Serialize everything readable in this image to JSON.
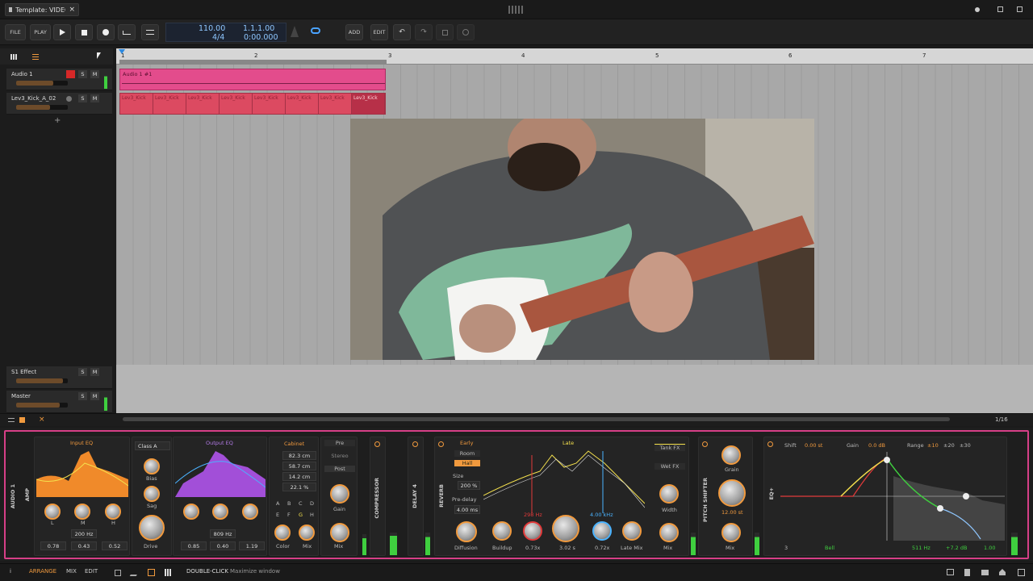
{
  "window": {
    "tab_title": "Template: VIDEO *",
    "close": "×"
  },
  "toolbar": {
    "file": "FILE",
    "play": "PLAY",
    "add": "ADD",
    "edit": "EDIT",
    "tempo": "110.00",
    "signature": "4/4",
    "position": "1.1.1.00",
    "time": "0:00.000"
  },
  "ruler": {
    "bars": [
      "1",
      "2",
      "3",
      "4",
      "5",
      "6",
      "7"
    ]
  },
  "tracks": [
    {
      "name": "Audio 1",
      "level": 0.72,
      "s": "S",
      "m": "M"
    },
    {
      "name": "Lev3_Kick_A_02",
      "level": 0.65,
      "s": "S",
      "m": "M"
    },
    {
      "name": "S1 Effect",
      "level": 0.9,
      "s": "S",
      "m": "M"
    },
    {
      "name": "Master",
      "level": 0.85,
      "s": "S",
      "m": "M"
    }
  ],
  "add_track": "+",
  "clips": {
    "audio_label": "Audio 1 #1",
    "kick_labels": [
      "Lev3_Kick",
      "Lev3_Kick",
      "Lev3_Kick",
      "Lev3_Kick",
      "Lev3_Kick",
      "Lev3_Kick",
      "Lev3_Kick",
      "Lev3_Kick"
    ]
  },
  "arrange_footer": {
    "grid": "1/16"
  },
  "amp": {
    "track_label": "AUDIO 1",
    "device": "AMP",
    "input_eq": "Input EQ",
    "mode": "Class A",
    "bias": "Bias",
    "sag": "Sag",
    "drive": "Drive",
    "output_eq": "Output EQ",
    "lmh": [
      "L",
      "M",
      "H"
    ],
    "in_vals": [
      "0.78",
      "0.43",
      "0.52"
    ],
    "in_freq": "200 Hz",
    "out_vals": [
      "0.85",
      "0.40",
      "1.19"
    ],
    "out_freq": "809 Hz",
    "cabinet": "Cabinet",
    "cab_vals": [
      "82.3 cm",
      "58.7 cm",
      "14.2 cm",
      "22.1 %"
    ],
    "cab_letters": [
      "A",
      "B",
      "C",
      "D",
      "E",
      "F",
      "G",
      "H"
    ],
    "color": "Color",
    "mix": "Mix",
    "pre": "Pre",
    "stereo": "Stereo",
    "post": "Post",
    "gain": "Gain",
    "mix2": "Mix"
  },
  "compressor": "COMPRESSOR",
  "delay": "DELAY 4",
  "reverb": {
    "device": "REVERB",
    "early": "Early",
    "room": "Room",
    "hall": "Hall",
    "size": "Size",
    "size_val": "200 %",
    "predelay": "Pre-delay",
    "predelay_val": "4.00 ms",
    "diffusion": "Diffusion",
    "late": "Late",
    "low_freq": "298 Hz",
    "high_freq": "4.00 kHz",
    "buildup": "Buildup",
    "val1": "0.73x",
    "val2": "3.02 s",
    "val3": "0.72x",
    "late_mix": "Late Mix",
    "tank": "Tank FX",
    "wet": "Wet FX",
    "width": "Width",
    "mix": "Mix"
  },
  "pitch": {
    "device": "PITCH SHIFTER",
    "grain": "Grain",
    "value": "12.00 st",
    "mix": "Mix"
  },
  "eq": {
    "device": "EQ+",
    "shift": "Shift",
    "shift_val": "0.00 st",
    "gain": "Gain",
    "gain_val": "0.0 dB",
    "range": "Range",
    "ranges": [
      "±10",
      "±20",
      "±30"
    ],
    "band": "3",
    "type": "Bell",
    "freq": "511 Hz",
    "gain2": "+7.2 dB",
    "q": "1.00"
  },
  "status": {
    "arrange": "ARRANGE",
    "mix": "MIX",
    "edit": "EDIT",
    "hint_key": "DOUBLE-CLICK",
    "hint": "Maximize window"
  }
}
